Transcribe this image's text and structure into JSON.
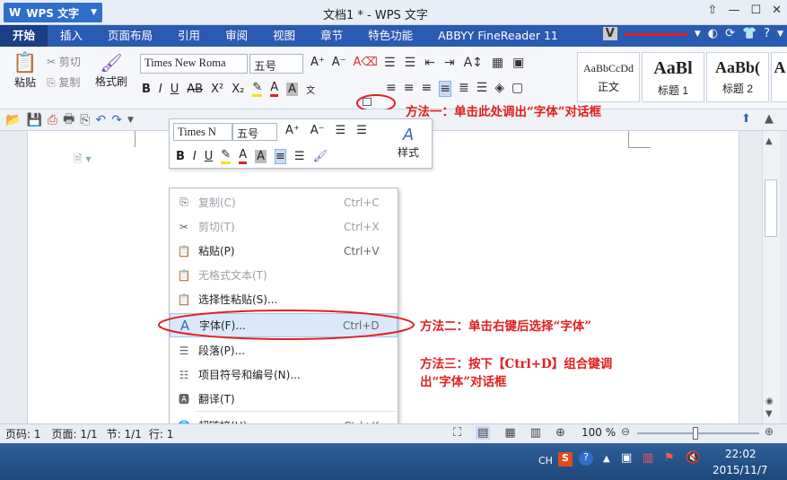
{
  "app": {
    "name": "WPS 文字",
    "doc_title": "文档1 * - WPS 文字"
  },
  "tabs": [
    "开始",
    "插入",
    "页面布局",
    "引用",
    "审阅",
    "视图",
    "章节",
    "特色功能",
    "ABBYY FineReader 11"
  ],
  "ribbon": {
    "paste": "粘贴",
    "cut": "剪切",
    "copy": "复制",
    "format_painter": "格式刷",
    "font_name": "Times New Roma",
    "font_size": "五号",
    "styles": [
      {
        "sample": "AaBbCcDd",
        "name": "正文"
      },
      {
        "sample": "AaBl",
        "name": "标题 1"
      },
      {
        "sample": "AaBb(",
        "name": "标题 2"
      },
      {
        "sample": "A",
        "name": ""
      }
    ]
  },
  "mini_toolbar": {
    "font_name": "Times N",
    "font_size": "五号",
    "styles_label": "样式"
  },
  "context_menu": [
    {
      "label": "复制(C)",
      "shortcut": "Ctrl+C",
      "disabled": true,
      "icon": "copy-icon"
    },
    {
      "label": "剪切(T)",
      "shortcut": "Ctrl+X",
      "disabled": true,
      "icon": "scissors-icon"
    },
    {
      "label": "粘贴(P)",
      "shortcut": "Ctrl+V",
      "disabled": false,
      "icon": "paste-icon"
    },
    {
      "label": "无格式文本(T)",
      "shortcut": "",
      "disabled": true,
      "icon": "plain-text-icon"
    },
    {
      "label": "选择性粘贴(S)...",
      "shortcut": "",
      "disabled": false,
      "icon": "paste-special-icon"
    },
    {
      "label": "字体(F)...",
      "shortcut": "Ctrl+D",
      "disabled": false,
      "icon": "font-icon",
      "highlighted": true
    },
    {
      "label": "段落(P)...",
      "shortcut": "",
      "disabled": false,
      "icon": "paragraph-icon"
    },
    {
      "label": "项目符号和编号(N)...",
      "shortcut": "",
      "disabled": false,
      "icon": "bullets-icon"
    },
    {
      "label": "翻译(T)",
      "shortcut": "",
      "disabled": false,
      "icon": "translate-icon"
    },
    {
      "label": "超链接(H)...",
      "shortcut": "Ctrl+K",
      "disabled": false,
      "icon": "hyperlink-icon"
    }
  ],
  "annotations": {
    "method1": "方法一：单击此处调出“字体”对话框",
    "method2": "方法二：单击右键后选择“字体”",
    "method3_line1": "方法三：按下【Ctrl+D】组合键调",
    "method3_line2": "出“字体”对话框"
  },
  "status": {
    "page_num": "页码: 1",
    "pages": "页面: 1/1",
    "section": "节: 1/1",
    "row": "行: 1",
    "zoom": "100 %"
  },
  "taskbar": {
    "ime": "CH",
    "time": "22:02",
    "date": "2015/11/7"
  },
  "colors": {
    "accent": "#2a5bb3",
    "annotation": "#e02020"
  }
}
